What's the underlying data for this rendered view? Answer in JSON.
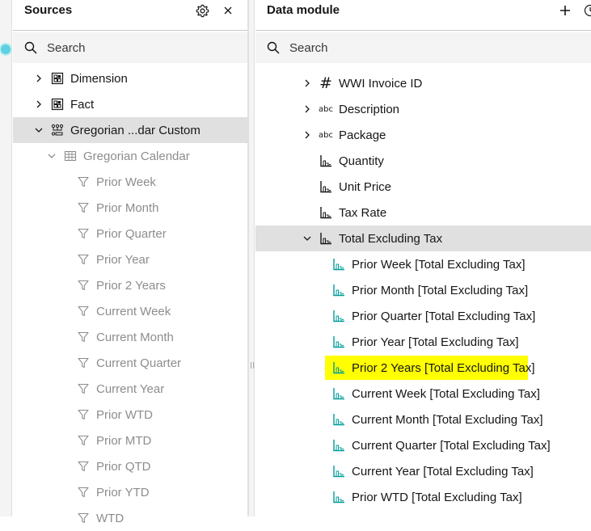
{
  "sources": {
    "title": "Sources",
    "search_placeholder": "Search",
    "tree": [
      {
        "label": "Dimension",
        "icon": "model-icon",
        "chevron": "right"
      },
      {
        "label": "Fact",
        "icon": "model-icon",
        "chevron": "right"
      },
      {
        "label": "Gregorian ...dar Custom",
        "icon": "hierarchy-icon",
        "chevron": "down",
        "selected": true
      },
      {
        "label": "Gregorian Calendar",
        "icon": "table-icon",
        "chevron": "down"
      },
      {
        "label": "Prior Week",
        "icon": "filter-icon"
      },
      {
        "label": "Prior Month",
        "icon": "filter-icon"
      },
      {
        "label": "Prior Quarter",
        "icon": "filter-icon"
      },
      {
        "label": "Prior Year",
        "icon": "filter-icon"
      },
      {
        "label": "Prior 2 Years",
        "icon": "filter-icon"
      },
      {
        "label": "Current Week",
        "icon": "filter-icon"
      },
      {
        "label": "Current Month",
        "icon": "filter-icon"
      },
      {
        "label": "Current Quarter",
        "icon": "filter-icon"
      },
      {
        "label": "Current Year",
        "icon": "filter-icon"
      },
      {
        "label": "Prior WTD",
        "icon": "filter-icon"
      },
      {
        "label": "Prior MTD",
        "icon": "filter-icon"
      },
      {
        "label": "Prior QTD",
        "icon": "filter-icon"
      },
      {
        "label": "Prior YTD",
        "icon": "filter-icon"
      },
      {
        "label": "WTD",
        "icon": "filter-icon"
      }
    ]
  },
  "module": {
    "title": "Data module",
    "search_placeholder": "Search",
    "tree": [
      {
        "label": "WWI Invoice ID",
        "icon": "hash-icon",
        "chevron": "right"
      },
      {
        "label": "Description",
        "icon": "abc-icon",
        "chevron": "right"
      },
      {
        "label": "Package",
        "icon": "abc-icon",
        "chevron": "right"
      },
      {
        "label": "Quantity",
        "icon": "measure-icon"
      },
      {
        "label": "Unit Price",
        "icon": "measure-icon"
      },
      {
        "label": "Tax Rate",
        "icon": "measure-icon"
      },
      {
        "label": "Total Excluding Tax",
        "icon": "measure-icon",
        "chevron": "down",
        "selected": true
      },
      {
        "label": "Prior Week [Total Excluding Tax]",
        "icon": "relative-measure-icon"
      },
      {
        "label": "Prior Month [Total Excluding Tax]",
        "icon": "relative-measure-icon"
      },
      {
        "label": "Prior Quarter [Total Excluding Tax]",
        "icon": "relative-measure-icon"
      },
      {
        "label": "Prior Year [Total Excluding Tax]",
        "icon": "relative-measure-icon"
      },
      {
        "label": "Prior 2 Years [Total Excluding Tax]",
        "icon": "relative-measure-icon",
        "highlighted": true
      },
      {
        "label": "Current Week [Total Excluding Tax]",
        "icon": "relative-measure-icon"
      },
      {
        "label": "Current Month [Total Excluding Tax]",
        "icon": "relative-measure-icon"
      },
      {
        "label": "Current Quarter [Total Excluding Tax]",
        "icon": "relative-measure-icon"
      },
      {
        "label": "Current Year [Total Excluding Tax]",
        "icon": "relative-measure-icon"
      },
      {
        "label": "Prior WTD [Total Excluding Tax]",
        "icon": "relative-measure-icon"
      }
    ]
  },
  "colors": {
    "selected_row": "#e0e0e0",
    "highlight": "#ffff00",
    "relative_measure_teal": "#009d9a",
    "dim_text": "#8d8d8d"
  }
}
